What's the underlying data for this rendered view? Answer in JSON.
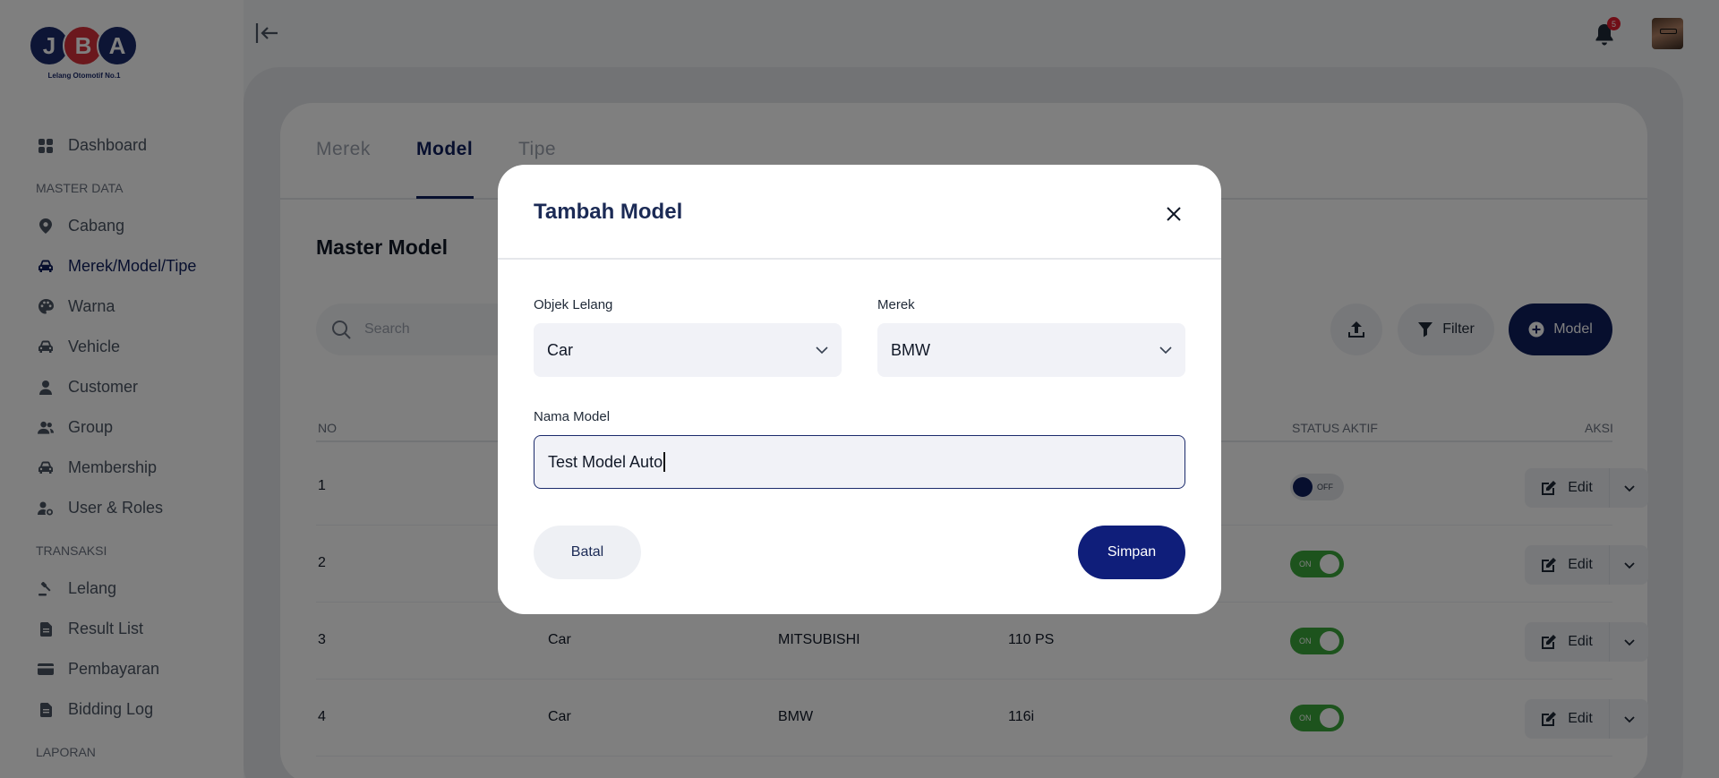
{
  "brand": {
    "letters": [
      "J",
      "B",
      "A"
    ],
    "tagline": "Lelang Otomotif No.1",
    "colors": {
      "navy": "#1b2a6b",
      "red": "#d6303a"
    }
  },
  "sidebar": {
    "top_items": [
      {
        "label": "Dashboard",
        "icon": "dashboard-icon"
      }
    ],
    "master_heading": "MASTER DATA",
    "master_items": [
      {
        "label": "Cabang",
        "icon": "map-pin-icon"
      },
      {
        "label": "Merek/Model/Tipe",
        "icon": "car-icon"
      },
      {
        "label": "Warna",
        "icon": "palette-icon"
      },
      {
        "label": "Vehicle",
        "icon": "car-icon"
      },
      {
        "label": "Customer",
        "icon": "user-icon"
      },
      {
        "label": "Group",
        "icon": "users-icon"
      },
      {
        "label": "Membership",
        "icon": "car-icon"
      },
      {
        "label": "User & Roles",
        "icon": "user-cog-icon"
      }
    ],
    "trans_heading": "TRANSAKSI",
    "trans_items": [
      {
        "label": "Lelang",
        "icon": "gavel-icon"
      },
      {
        "label": "Result List",
        "icon": "document-icon"
      },
      {
        "label": "Pembayaran",
        "icon": "credit-card-icon"
      },
      {
        "label": "Bidding Log",
        "icon": "document-icon"
      }
    ],
    "report_heading": "LAPORAN"
  },
  "topbar": {
    "notification_count": "5"
  },
  "tabs": [
    "Merek",
    "Model",
    "Tipe"
  ],
  "page": {
    "title": "Master Model",
    "search_placeholder": "Search",
    "filter_label": "Filter",
    "add_label": "Model"
  },
  "table": {
    "headers": {
      "no": "NO",
      "status": "STATUS AKTIF",
      "aksi": "AKSI"
    },
    "rows": [
      {
        "no": "1",
        "objek": "",
        "merek": "",
        "model": "",
        "status": "OFF"
      },
      {
        "no": "2",
        "objek": "",
        "merek": "",
        "model": "",
        "status": "ON"
      },
      {
        "no": "3",
        "objek": "Car",
        "merek": "MITSUBISHI",
        "model": "110 PS",
        "status": "ON"
      },
      {
        "no": "4",
        "objek": "Car",
        "merek": "BMW",
        "model": "116i",
        "status": "ON"
      }
    ],
    "edit_label": "Edit"
  },
  "modal": {
    "title": "Tambah Model",
    "objek_label": "Objek Lelang",
    "objek_value": "Car",
    "merek_label": "Merek",
    "merek_value": "BMW",
    "nama_label": "Nama Model",
    "nama_value": "Test Model Auto",
    "cancel_label": "Batal",
    "save_label": "Simpan",
    "primary_color": "#0f1e7a"
  }
}
